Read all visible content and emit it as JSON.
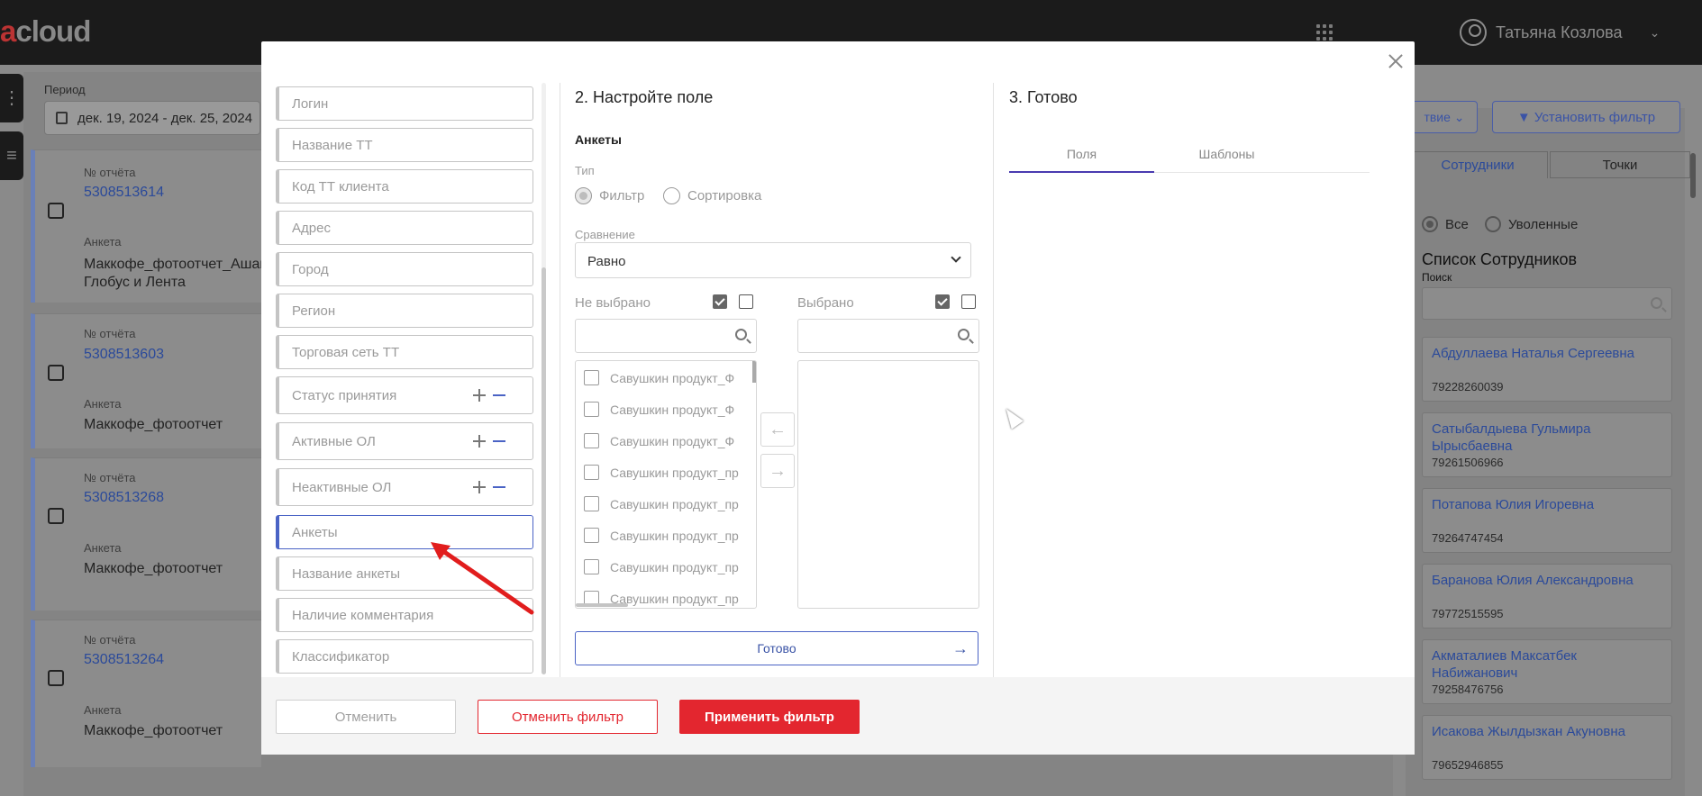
{
  "app": {
    "logo_prefix": "a",
    "logo_text": "cloud",
    "user_name": "Татьяна Козлова"
  },
  "background": {
    "period_label": "Период",
    "period_value": "дек. 19, 2024 - дек. 25, 2024",
    "report_label": "№ отчёта",
    "anketa_label": "Анкета",
    "reports": [
      {
        "number": "5308513614",
        "anketa": "Маккофе_фотоотчет_Ашан, Глобус и Лента"
      },
      {
        "number": "5308513603",
        "anketa": "Маккофе_фотоотчет"
      },
      {
        "number": "5308513268",
        "anketa": "Маккофе_фотоотчет"
      },
      {
        "number": "5308513264",
        "anketa": "Маккофе_фотоотчет"
      }
    ],
    "action_button": "твие",
    "set_filter_button": "Установить фильтр",
    "tab_employees": "Сотрудники",
    "tab_points": "Точки",
    "radio_all": "Все",
    "radio_fired": "Уволенные",
    "employees_title": "Список Сотрудников",
    "search_label": "Поиск",
    "employees": [
      {
        "name": "Абдуллаева Наталья Сергеевна",
        "phone": "79228260039"
      },
      {
        "name": "Сатыбалдыева Гульмира Ырысбаевна",
        "phone": "79261506966"
      },
      {
        "name": "Потапова Юлия Игоревна",
        "phone": "79264747454"
      },
      {
        "name": "Баранова Юлия Александровна",
        "phone": "79772515595"
      },
      {
        "name": "Акматалиев Максатбек Набижанович",
        "phone": "79258476756"
      },
      {
        "name": "Исакова Жылдызкан Акуновна",
        "phone": "79652946855"
      }
    ]
  },
  "modal": {
    "fields": [
      "Логин",
      "Название ТТ",
      "Код ТТ клиента",
      "Адрес",
      "Город",
      "Регион",
      "Торговая сеть ТТ",
      "Статус принятия",
      "Активные ОЛ",
      "Неактивные ОЛ",
      "Анкеты",
      "Название анкеты",
      "Наличие комментария",
      "Классификатор"
    ],
    "step2_title": "2. Настройте поле",
    "step2_subtitle": "Анкеты",
    "type_label": "Тип",
    "type_filter": "Фильтр",
    "type_sort": "Сортировка",
    "compare_label": "Сравнение",
    "compare_value": "Равно",
    "not_selected_label": "Не выбрано",
    "selected_label": "Выбрано",
    "list_items": [
      "Савушкин продукт_Ф",
      "Савушкин продукт_Ф",
      "Савушкин продукт_Ф",
      "Савушкин продукт_пр",
      "Савушкин продукт_пр",
      "Савушкин продукт_пр",
      "Савушкин продукт_пр",
      "Савушкин продукт_пр"
    ],
    "done_button": "Готово",
    "step3_title": "3. Готово",
    "tab_fields": "Поля",
    "tab_templates": "Шаблоны",
    "cancel_button": "Отменить",
    "cancel_filter_button": "Отменить фильтр",
    "apply_filter_button": "Применить фильтр"
  },
  "colors": {
    "accent": "#4a63c5",
    "danger": "#e3262f",
    "topbar": "#1b1b1b"
  }
}
